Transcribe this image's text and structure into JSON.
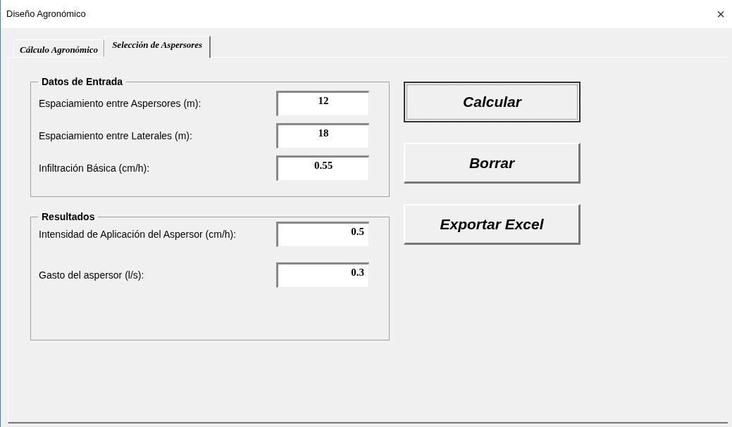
{
  "window": {
    "title": "Diseño Agronómico",
    "close": "×"
  },
  "tabs": [
    {
      "label": "Cálculo Agronómico",
      "selected": false
    },
    {
      "label": "Selección de Aspersores",
      "selected": true
    }
  ],
  "groups": [
    {
      "title": "Datos de Entrada",
      "kind": "input",
      "fields": [
        {
          "label": "Espaciamiento  entre Aspersores (m):",
          "value": "12"
        },
        {
          "label": "Espaciamiento  entre Laterales (m):",
          "value": "18"
        },
        {
          "label": "Infiltración Básica (cm/h):",
          "value": "0.55"
        }
      ]
    },
    {
      "title": "Resultados",
      "kind": "output",
      "fields": [
        {
          "label": "Intensidad de Aplicación del Aspersor (cm/h):",
          "value": "0.5"
        },
        {
          "label": "Gasto del aspersor  (l/s):",
          "value": "0.3"
        }
      ]
    }
  ],
  "buttons": [
    {
      "label": "Calcular",
      "focused": true
    },
    {
      "label": "Borrar",
      "focused": false
    },
    {
      "label": "Exportar Excel",
      "focused": false
    }
  ]
}
